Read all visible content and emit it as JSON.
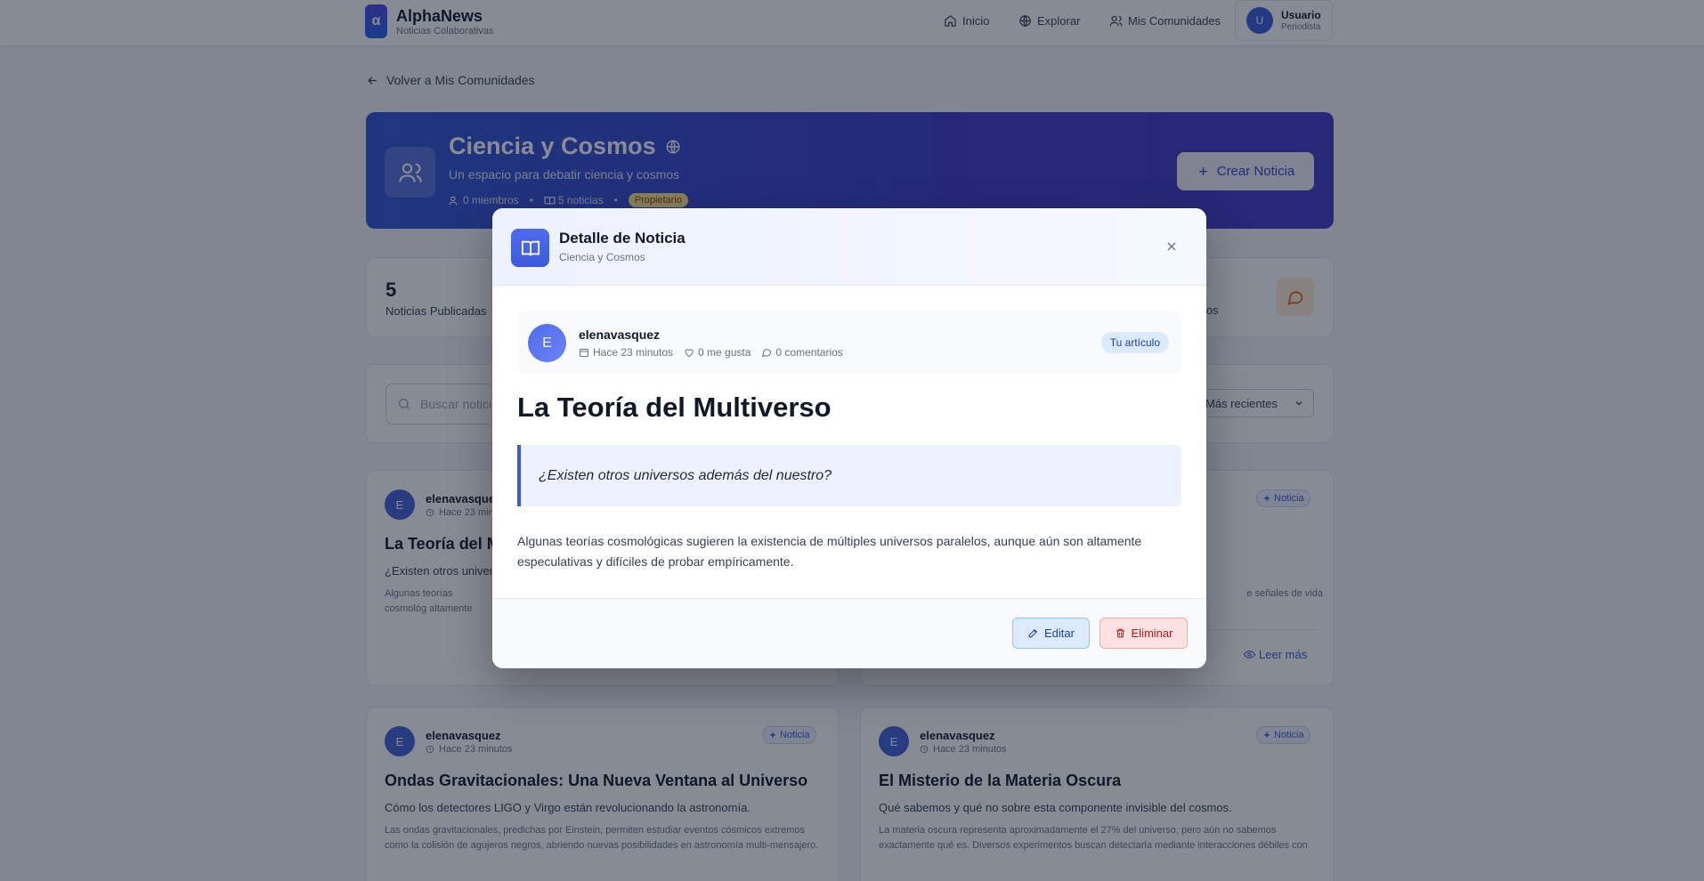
{
  "header": {
    "logo_letter": "α",
    "brand_name": "AlphaNews",
    "brand_tagline": "Noticias Colaborativas",
    "nav": [
      {
        "label": "Inicio",
        "icon": "home-icon"
      },
      {
        "label": "Explorar",
        "icon": "globe-icon"
      },
      {
        "label": "Mis Comunidades",
        "icon": "users-icon"
      }
    ],
    "user": {
      "initial": "U",
      "name": "Usuario",
      "role": "Periodista"
    }
  },
  "back_link": "Volver a Mis Comunidades",
  "community": {
    "name": "Ciencia y Cosmos",
    "description": "Un espacio para debatir ciencia y cosmos",
    "members": "0 miembros",
    "news_count": "5 noticias",
    "role_badge": "Propietario",
    "create_button": "Crear Noticia"
  },
  "stats": {
    "published_value": "5",
    "published_label": "Noticias Publicadas",
    "right_label_partial": "ios"
  },
  "filters": {
    "search_placeholder": "Buscar noticia",
    "sort_selected": "Más recientes"
  },
  "cards": [
    {
      "initial": "E",
      "author": "elenavasquez",
      "time": "Hace 23 minutos",
      "title": "La Teoría del M",
      "subtitle": "¿Existen otros univers",
      "body": "Algunas teorías cosmológ altamente especulativas y"
    },
    {
      "badge": "Noticia",
      "body_partial": "e señales de vida",
      "read_more": "Leer más"
    },
    {
      "initial": "E",
      "author": "elenavasquez",
      "time": "Hace 23 minutos",
      "badge": "Noticia",
      "title": "Ondas Gravitacionales: Una Nueva Ventana al Universo",
      "subtitle": "Cómo los detectores LIGO y Virgo están revolucionando la astronomía.",
      "body": "Las ondas gravitacionales, predichas por Einstein, permiten estudiar eventos cósmicos extremos como la colisión de agujeros negros, abriendo nuevas posibilidades en astronomía multi-mensajero."
    },
    {
      "initial": "E",
      "author": "elenavasquez",
      "time": "Hace 23 minutos",
      "badge": "Noticia",
      "title": "El Misterio de la Materia Oscura",
      "subtitle": "Qué sabemos y qué no sobre esta componente invisible del cosmos.",
      "body": "La materia oscura representa aproximadamente el 27% del universo, pero aún no sabemos exactamente qué es. Diversos experimentos buscan detectarla mediante interacciones débiles con l..."
    }
  ],
  "modal": {
    "title": "Detalle de Noticia",
    "subtitle": "Ciencia y Cosmos",
    "author_initial": "E",
    "author": "elenavasquez",
    "time": "Hace 23 minutos",
    "likes": "0 me gusta",
    "comments": "0 comentarios",
    "own_badge": "Tu artículo",
    "article_title": "La Teoría del Multiverso",
    "quote": "¿Existen otros universos además del nuestro?",
    "body": "Algunas teorías cosmológicas sugieren la existencia de múltiples universos paralelos, aunque aún son altamente especulativas y difíciles de probar empíricamente.",
    "edit_button": "Editar",
    "delete_button": "Eliminar"
  },
  "colors": {
    "accent": "#3b5bdb",
    "hero_start": "#2f55d4",
    "hero_end": "#4336c6",
    "danger": "#b91c1c"
  }
}
